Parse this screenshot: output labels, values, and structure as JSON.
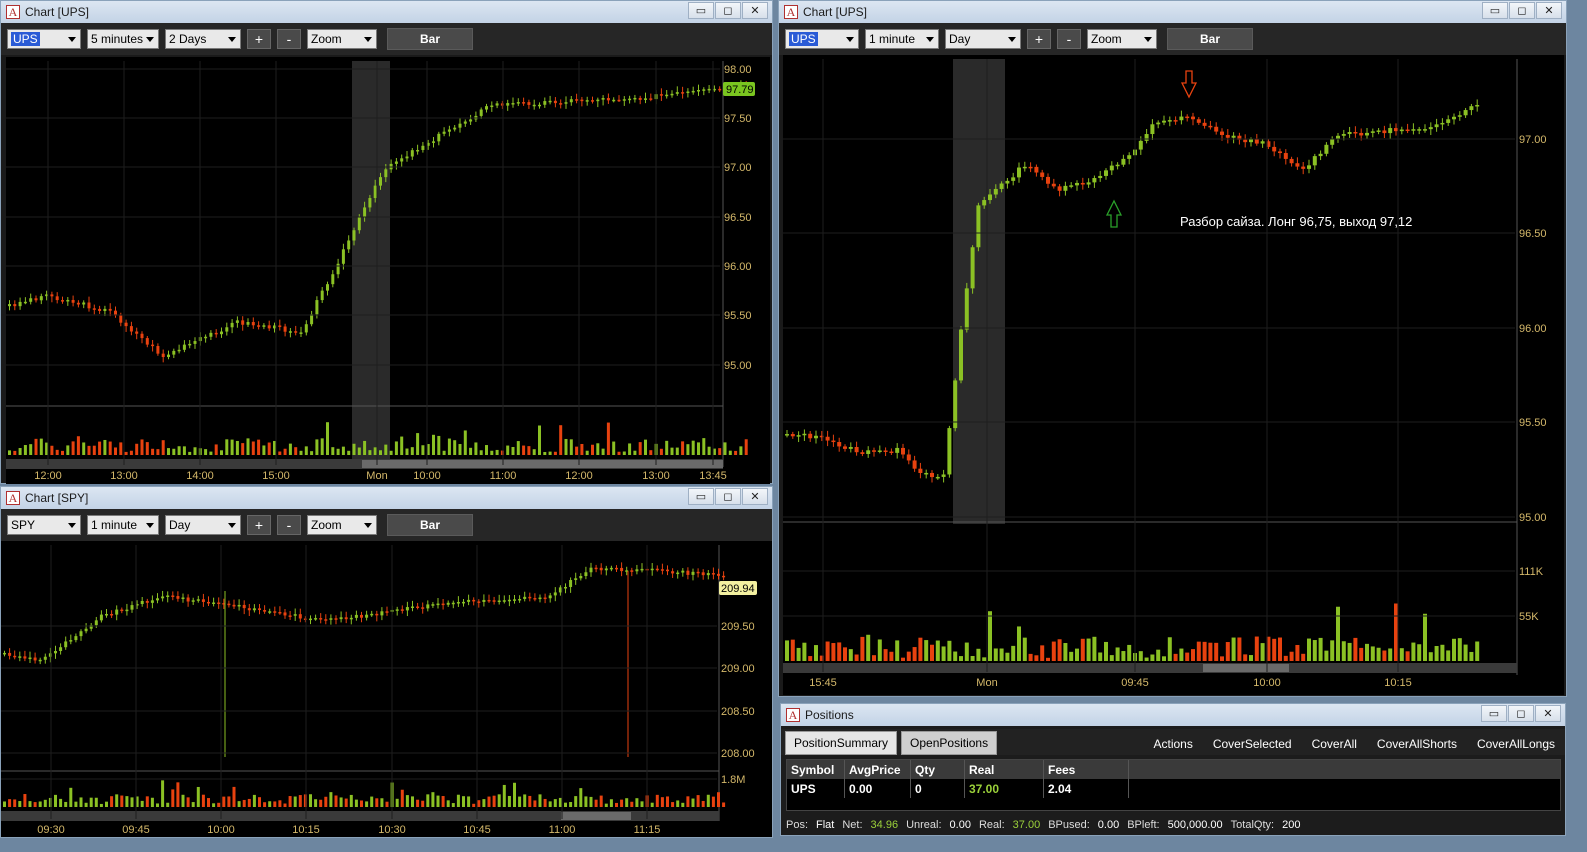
{
  "colors": {
    "up": "#8bc124",
    "down": "#e8420f",
    "axis_text": "#d4b86a",
    "price_tag_green": "#7ac520",
    "price_tag_yellow": "#f3f0a0",
    "highlight": "#2a2a2a"
  },
  "win_ups_5m": {
    "title": "Chart [UPS]",
    "symbol": "UPS",
    "interval": "5 minutes",
    "range": "2 Days",
    "plus": "+",
    "minus": "-",
    "zoom": "Zoom",
    "bar": "Bar",
    "last_price": "97.79",
    "y_ticks": [
      "98.00",
      "97.50",
      "97.00",
      "96.50",
      "96.00",
      "95.50",
      "95.00"
    ],
    "x_ticks": [
      "12:00",
      "13:00",
      "14:00",
      "15:00",
      "Mon",
      "10:00",
      "11:00",
      "12:00",
      "13:00",
      "13:45"
    ]
  },
  "win_spy": {
    "title": "Chart [SPY]",
    "symbol": "SPY",
    "interval": "1 minute",
    "range": "Day",
    "plus": "+",
    "minus": "-",
    "zoom": "Zoom",
    "bar": "Bar",
    "last_price": "209.94",
    "y_ticks": [
      "209.50",
      "209.00",
      "208.50",
      "208.00"
    ],
    "vol_tick": "1.8M",
    "x_ticks": [
      "09:30",
      "09:45",
      "10:00",
      "10:15",
      "10:30",
      "10:45",
      "11:00",
      "11:15"
    ]
  },
  "win_ups_1m": {
    "title": "Chart [UPS]",
    "symbol": "UPS",
    "interval": "1 minute",
    "range": "Day",
    "plus": "+",
    "minus": "-",
    "zoom": "Zoom",
    "bar": "Bar",
    "annotation": "Разбор сайза. Лонг  96,75, выход 97,12",
    "y_ticks": [
      "97.00",
      "96.50",
      "96.00",
      "95.50",
      "95.00"
    ],
    "vol_ticks": [
      "111K",
      "55K"
    ],
    "x_ticks": [
      "15:45",
      "Mon",
      "09:45",
      "10:00",
      "10:15"
    ]
  },
  "positions": {
    "title": "Positions",
    "tabs": [
      "PositionSummary",
      "OpenPositions"
    ],
    "actions": [
      "Actions",
      "CoverSelected",
      "CoverAll",
      "CoverAllShorts",
      "CoverAllLongs"
    ],
    "columns": [
      "Symbol",
      "AvgPrice",
      "Qty",
      "Real",
      "Fees"
    ],
    "row": [
      "UPS",
      "0.00",
      "0",
      "37.00",
      "2.04"
    ],
    "status": {
      "pos_label": "Pos:",
      "pos": "Flat",
      "net_label": "Net:",
      "net": "34.96",
      "unreal_label": "Unreal:",
      "unreal": "0.00",
      "real_label": "Real:",
      "real": "37.00",
      "bpused_label": "BPused:",
      "bpused": "0.00",
      "bpleft_label": "BPleft:",
      "bpleft": "500,000.00",
      "totalqty_label": "TotalQty:",
      "totalqty": "200"
    }
  },
  "window_controls": {
    "minimize": "▭",
    "maximize": "◻",
    "close": "✕"
  }
}
